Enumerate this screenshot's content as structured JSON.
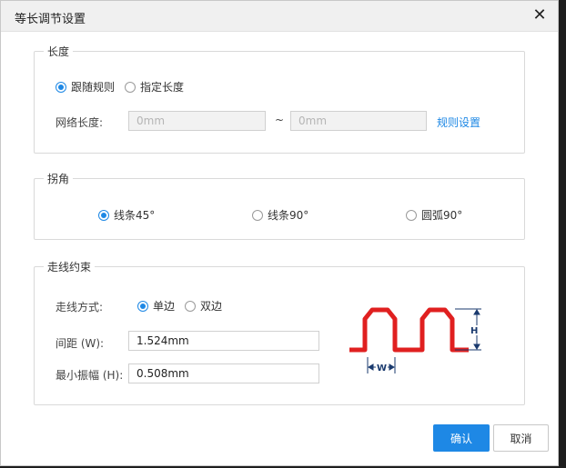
{
  "dialog": {
    "title": "等长调节设置",
    "close_glyph": "✕"
  },
  "length_group": {
    "legend": "长度",
    "options": [
      "跟随规则",
      "指定长度"
    ],
    "selected": "跟随规则",
    "net_length_label": "网络长度:",
    "min_placeholder": "0mm",
    "separator": "~",
    "max_placeholder": "0mm",
    "rule_link": "规则设置"
  },
  "corner_group": {
    "legend": "拐角",
    "options": [
      "线条45°",
      "线条90°",
      "圆弧90°"
    ],
    "selected": "线条45°"
  },
  "routing_group": {
    "legend": "走线约束",
    "mode_label": "走线方式:",
    "mode_options": [
      "单边",
      "双边"
    ],
    "mode_selected": "单边",
    "gap_label": "间距 (W):",
    "gap_value": "1.524mm",
    "amplitude_label": "最小振幅 (H):",
    "amplitude_value": "0.508mm",
    "diagram": {
      "h_label": "H",
      "w_label": "W",
      "trace_color": "#e02020",
      "dim_color": "#1a3a6e"
    }
  },
  "footer": {
    "confirm": "确认",
    "cancel": "取消"
  },
  "colors": {
    "accent": "#1e88e5"
  }
}
